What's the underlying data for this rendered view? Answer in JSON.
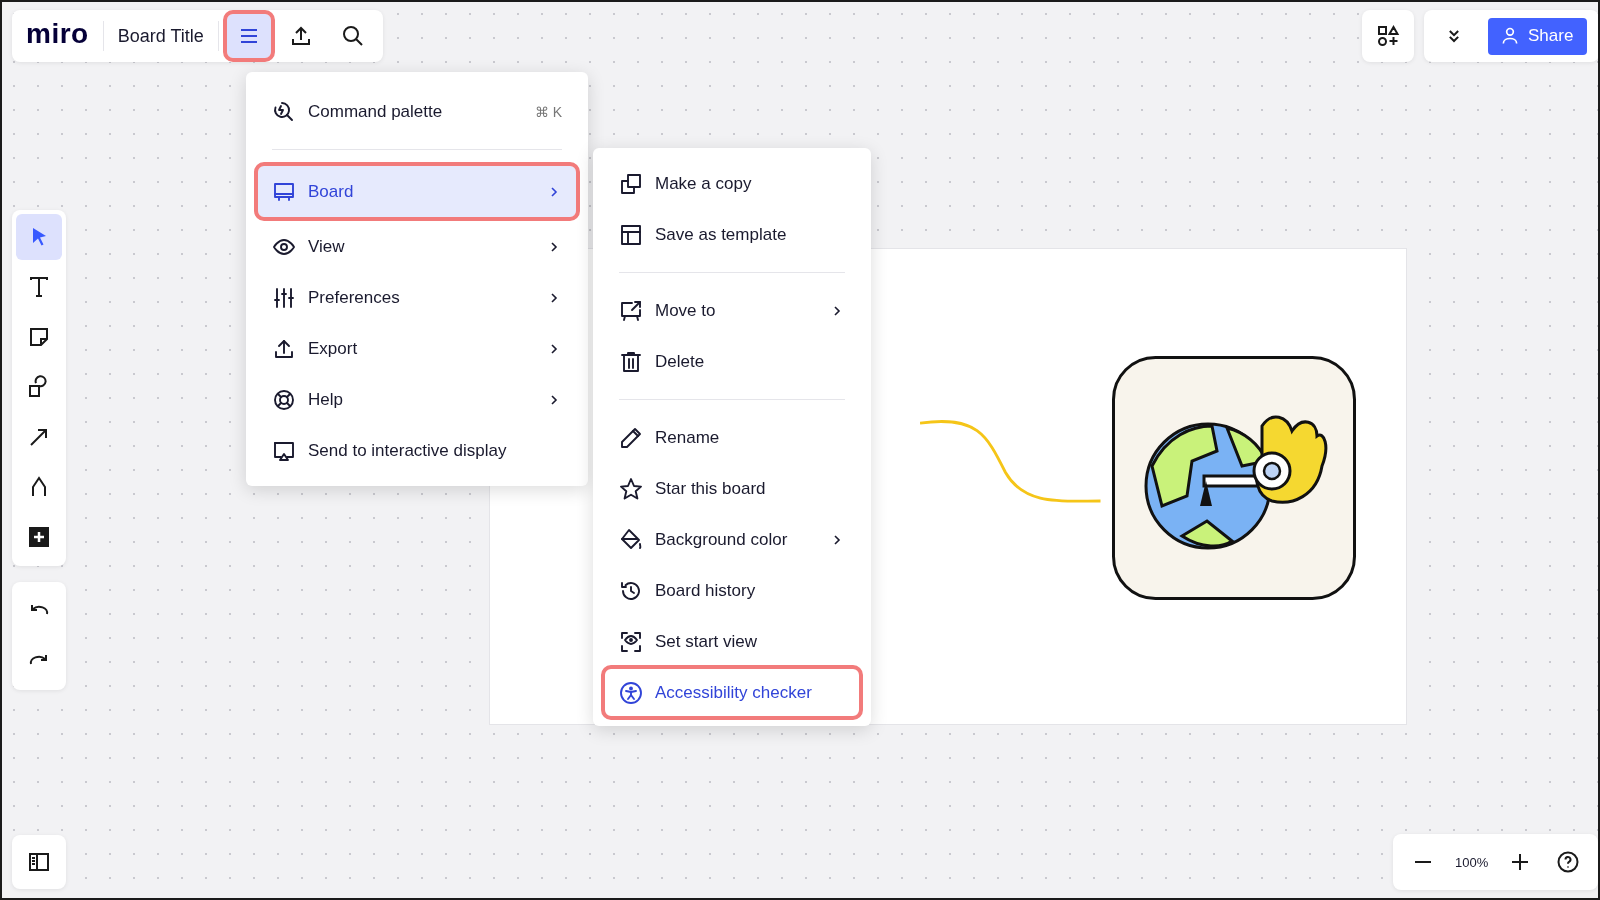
{
  "topbar": {
    "logo": "miro",
    "board_title": "Board Title",
    "menu_button": {
      "selected": true
    }
  },
  "share_button": {
    "label": "Share"
  },
  "main_menu": {
    "items": [
      {
        "label": "Command palette",
        "shortcut": "⌘ K",
        "submenu": false,
        "selected": false
      },
      {
        "label": "Board",
        "submenu": true,
        "selected": true
      },
      {
        "label": "View",
        "submenu": true,
        "selected": false
      },
      {
        "label": "Preferences",
        "submenu": true,
        "selected": false
      },
      {
        "label": "Export",
        "submenu": true,
        "selected": false
      },
      {
        "label": "Help",
        "submenu": true,
        "selected": false
      },
      {
        "label": "Send to interactive display",
        "submenu": false,
        "selected": false
      }
    ]
  },
  "board_menu": {
    "groups": [
      [
        {
          "label": "Make a copy",
          "submenu": false,
          "selected": false
        },
        {
          "label": "Save as template",
          "submenu": false,
          "selected": false
        }
      ],
      [
        {
          "label": "Move to",
          "submenu": true,
          "selected": false
        },
        {
          "label": "Delete",
          "submenu": false,
          "selected": false
        }
      ],
      [
        {
          "label": "Rename",
          "submenu": false,
          "selected": false
        },
        {
          "label": "Star this board",
          "submenu": false,
          "selected": false
        },
        {
          "label": "Background color",
          "submenu": true,
          "selected": false
        },
        {
          "label": "Board history",
          "submenu": false,
          "selected": false
        },
        {
          "label": "Set start view",
          "submenu": false,
          "selected": false
        },
        {
          "label": "Accessibility checker",
          "submenu": false,
          "selected": true
        }
      ]
    ]
  },
  "tools": [
    {
      "selected": true
    },
    {
      "selected": false
    },
    {
      "selected": false
    },
    {
      "selected": false
    },
    {
      "selected": false
    },
    {
      "selected": false
    },
    {
      "selected": false
    }
  ],
  "zoom": {
    "value": "100%"
  }
}
